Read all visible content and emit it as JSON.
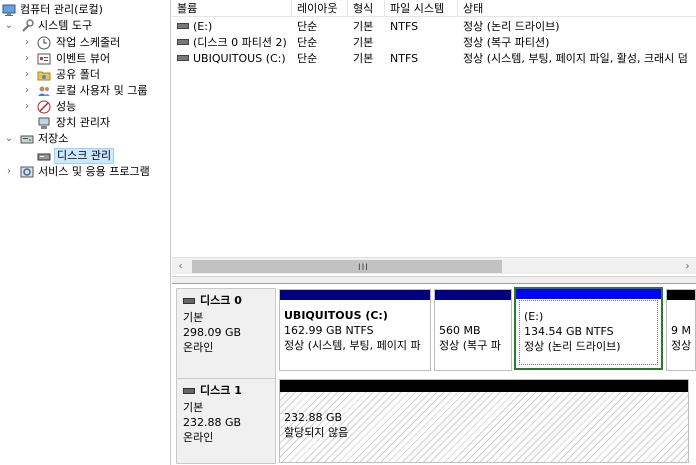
{
  "tree": {
    "root": "컴퓨터 관리(로컬)",
    "system_tools": "시스템 도구",
    "task_scheduler": "작업 스케줄러",
    "event_viewer": "이벤트 뷰어",
    "shared_folders": "공유 폴더",
    "local_users": "로컬 사용자 및 그룹",
    "performance": "성능",
    "device_manager": "장치 관리자",
    "storage": "저장소",
    "disk_management": "디스크 관리",
    "services": "서비스 및 응용 프로그램"
  },
  "list": {
    "columns": [
      "볼륨",
      "레이아웃",
      "형식",
      "파일 시스템",
      "상태"
    ],
    "rows": [
      {
        "volume": "(E:)",
        "layout": "단순",
        "type": "기본",
        "fs": "NTFS",
        "status": "정상 (논리 드라이브)"
      },
      {
        "volume": "(디스크 0 파티션 2)",
        "layout": "단순",
        "type": "기본",
        "fs": "",
        "status": "정상 (복구 파티션)"
      },
      {
        "volume": "UBIQUITOUS (C:)",
        "layout": "단순",
        "type": "기본",
        "fs": "NTFS",
        "status": "정상 (시스템, 부팅, 페이지 파일, 활성, 크래시 덤"
      }
    ],
    "scroll_grip": "III"
  },
  "disks": [
    {
      "name": "디스크 0",
      "kind": "기본",
      "size": "298.09 GB",
      "state": "온라인",
      "partitions": [
        {
          "name": "UBIQUITOUS  (C:)",
          "size": "162.99 GB NTFS",
          "status": "정상 (시스템, 부팅, 페이지 파",
          "bar_color": "#000080"
        },
        {
          "name": "",
          "size": "560 MB",
          "status": "정상 (복구 파",
          "bar_color": "#000080"
        },
        {
          "name": "(E:)",
          "size": "134.54 GB NTFS",
          "status": "정상 (논리 드라이브)",
          "bar_color": "#0000ff"
        },
        {
          "name": "",
          "size": "9 M",
          "status": "정상",
          "bar_color": "#000000"
        }
      ]
    },
    {
      "name": "디스크 1",
      "kind": "기본",
      "size": "232.88 GB",
      "state": "온라인",
      "partitions": [
        {
          "name": "",
          "size": "232.88 GB",
          "status": "할당되지 않음",
          "bar_color": "#000000"
        }
      ]
    }
  ],
  "colors": {
    "primary_partition": "#000080",
    "logical_drive": "#0000ff",
    "unallocated": "#000000",
    "selection_border": "#2c7a2c"
  }
}
